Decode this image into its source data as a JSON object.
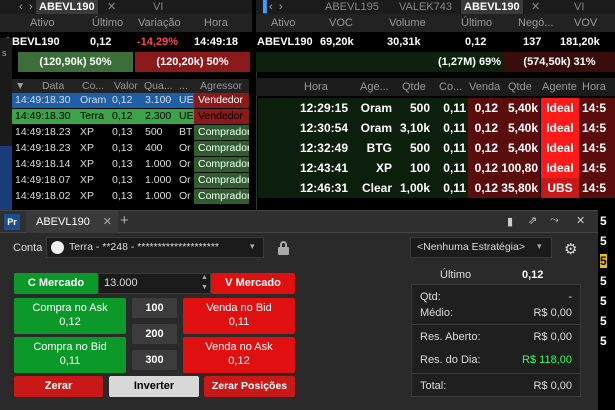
{
  "left_tabs": {
    "ticker": "ABEVL190",
    "other": "VI"
  },
  "left_header": [
    "Ativo",
    "Último",
    "Variação",
    "Hora"
  ],
  "left_quote": {
    "ativo": "ABEVL190",
    "ultimo": "0,12",
    "variacao": "-14,29%",
    "hora": "14:49:18"
  },
  "left_book": {
    "buy": "(120,90k) 50%",
    "sell": "(120,20k) 50%"
  },
  "left_trades_header": [
    "Data",
    "Co...",
    "Valor",
    "Qua...",
    "...",
    "Agressor"
  ],
  "left_trades": [
    {
      "data": "14:49:18.30",
      "co": "Oram",
      "valor": "0,12",
      "qtd": "3.100",
      "x": "UE",
      "agr": "Vendedor",
      "sel": true
    },
    {
      "data": "14:49:18.30",
      "co": "Terra",
      "valor": "0,12",
      "qtd": "2.300",
      "x": "UE",
      "agr": "Vendedor",
      "sel": false
    },
    {
      "data": "14:49:18.23",
      "co": "XP",
      "valor": "0,13",
      "qtd": "500",
      "x": "BT",
      "agr": "Comprador",
      "sel": false
    },
    {
      "data": "14:49:18.23",
      "co": "XP",
      "valor": "0,13",
      "qtd": "400",
      "x": "Or",
      "agr": "Comprador",
      "sel": false
    },
    {
      "data": "14:49:18.14",
      "co": "XP",
      "valor": "0,13",
      "qtd": "1.000",
      "x": "Or",
      "agr": "Comprador",
      "sel": false
    },
    {
      "data": "14:49:18.07",
      "co": "XP",
      "valor": "0,13",
      "qtd": "1.000",
      "x": "Or",
      "agr": "Comprador",
      "sel": false
    },
    {
      "data": "14:49:18.02",
      "co": "XP",
      "valor": "0,13",
      "qtd": "1.000",
      "x": "Or",
      "agr": "Comprador",
      "sel": false
    }
  ],
  "right_tabs": [
    "ABEVL195",
    "VALEK743",
    "ABEVL190",
    "VI"
  ],
  "right_header": [
    "Ativo",
    "VOC",
    "Volume",
    "Último",
    "Negó...",
    "VOV"
  ],
  "right_quote": {
    "ativo": "ABEVL190",
    "voc": "69,20k",
    "volume": "30,31k",
    "ultimo": "0,12",
    "neg": "137",
    "vov": "181,20k"
  },
  "right_book": {
    "buy": "(1,27M) 69%",
    "sell": "(574,50k) 31%"
  },
  "right_trades_header": [
    "Hora",
    "Age...",
    "Qtde",
    "Co...",
    "Venda",
    "Qtde",
    "Agente",
    "Hora"
  ],
  "right_trades": [
    {
      "hora": "12:29:15",
      "agente": "Oram",
      "qtde": "500",
      "compra": "0,11",
      "venda": "0,12",
      "qtde2": "5,40k",
      "agente2": "Ideal",
      "hora2": "14:5"
    },
    {
      "hora": "12:30:54",
      "agente": "Oram",
      "qtde": "3,10k",
      "compra": "0,11",
      "venda": "0,12",
      "qtde2": "5,40k",
      "agente2": "Ideal",
      "hora2": "14:5"
    },
    {
      "hora": "12:32:49",
      "agente": "BTG",
      "qtde": "500",
      "compra": "0,11",
      "venda": "0,12",
      "qtde2": "5,40k",
      "agente2": "Ideal",
      "hora2": "14:5"
    },
    {
      "hora": "12:43:41",
      "agente": "XP",
      "qtde": "100",
      "compra": "0,11",
      "venda": "0,12",
      "qtde2": "100,80",
      "agente2": "Ideal",
      "hora2": "14:5"
    },
    {
      "hora": "12:46:31",
      "agente": "Clear",
      "qtde": "1,00k",
      "compra": "0,11",
      "venda": "0,12",
      "qtde2": "35,80k",
      "agente2": "UBS",
      "hora2": "14:5"
    }
  ],
  "boleta": {
    "app_icon": "Pr",
    "tab_title": "ABEVL190",
    "conta_label": "Conta",
    "conta_value": "Terra - **248 - ********************",
    "strategy": "<Nenhuma Estratégia>",
    "c_mercado": "C Mercado",
    "v_mercado": "V Mercado",
    "quantity": "13.000",
    "compra_ask_label": "Compra no Ask",
    "compra_ask_price": "0,12",
    "compra_bid_label": "Compra no Bid",
    "compra_bid_price": "0,11",
    "venda_bid_label": "Venda no Bid",
    "venda_bid_price": "0,11",
    "venda_ask_label": "Venda no Ask",
    "venda_ask_price": "0,12",
    "q100": "100",
    "q200": "200",
    "q300": "300",
    "zerar": "Zerar",
    "inverter": "Inverter",
    "zerar_posicoes": "Zerar Posições",
    "ultimo_label": "Último",
    "ultimo_value": "0,12",
    "qtd_label": "Qtd:",
    "qtd_value": "-",
    "medio_label": "Médio:",
    "medio_value": "R$ 0,00",
    "res_aberto_label": "Res. Aberto:",
    "res_aberto_value": "R$ 0,00",
    "res_dia_label": "Res. do Dia:",
    "res_dia_value": "R$ 118,00",
    "total_label": "Total:",
    "total_value": "R$ 0,00"
  },
  "right_edge_values": [
    "5",
    "5",
    "5",
    "5",
    "5",
    "5",
    "5"
  ],
  "colors": {
    "buy": "#0b9a2a",
    "sell": "#e01010",
    "ideal": "#ff1a1a",
    "positive": "#33ff66"
  }
}
